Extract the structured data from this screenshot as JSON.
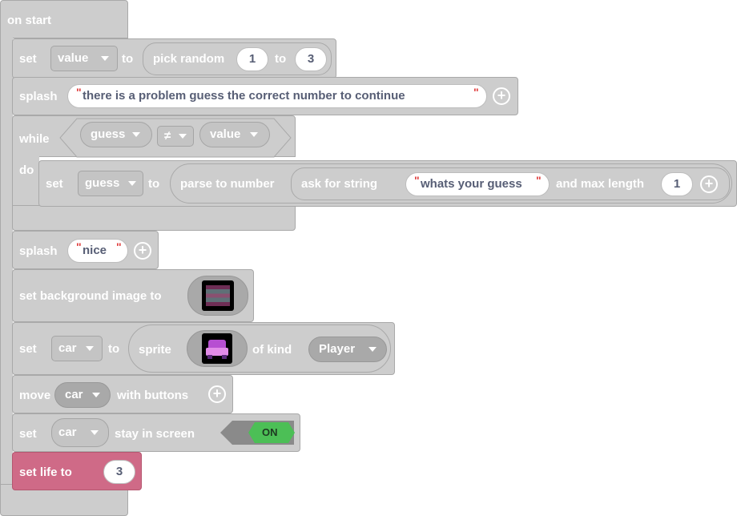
{
  "blocks": {
    "on_start": {
      "label": "on start"
    },
    "set_value": {
      "set": "set",
      "variable": "value",
      "to": "to",
      "pick_random": "pick random",
      "from": "1",
      "between": "to",
      "upto": "3"
    },
    "splash1": {
      "label": "splash",
      "text": "there is a problem guess the correct number to continue"
    },
    "while": {
      "label": "while",
      "do": "do",
      "left": "guess",
      "op": "≠",
      "right": "value"
    },
    "set_guess": {
      "set": "set",
      "variable": "guess",
      "to": "to",
      "parse": "parse to number",
      "ask": "ask for string",
      "prompt": "whats your guess",
      "max_len_label": "and max length",
      "max_len": "1"
    },
    "splash2": {
      "label": "splash",
      "text": "nice"
    },
    "set_bg": {
      "label": "set background image to"
    },
    "set_car": {
      "set": "set",
      "variable": "car",
      "to": "to",
      "sprite": "sprite",
      "of_kind": "of kind",
      "kind": "Player"
    },
    "move": {
      "label": "move",
      "variable": "car",
      "with": "with buttons"
    },
    "stay": {
      "set": "set",
      "variable": "car",
      "stay": "stay in screen",
      "toggle": "ON"
    },
    "life": {
      "label": "set life to",
      "value": "3"
    }
  },
  "quote": "\"",
  "icons": {
    "plus": "plus-circle-icon",
    "dropdown": "chevron-down-icon"
  },
  "colors": {
    "block": "#cdcdcd",
    "info": "#cf6a87",
    "toggle_on": "#4cbf56"
  }
}
